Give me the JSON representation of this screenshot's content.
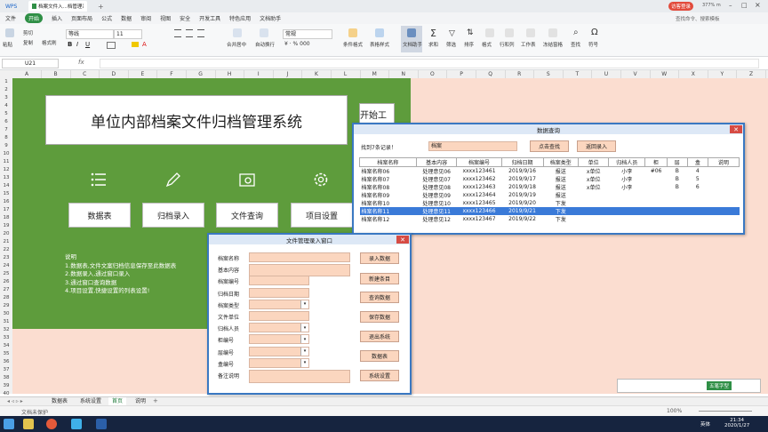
{
  "titlebar": {
    "app_label": "WPS",
    "tab_home": "首页",
    "doc_tab": "档案文件入...档管理系统",
    "login_btn": "访客登录",
    "time_label": "377% m"
  },
  "menubar": {
    "file": "文件",
    "start": "开始",
    "items": [
      "插入",
      "页面布局",
      "公式",
      "数据",
      "审阅",
      "视图",
      "安全",
      "开发工具",
      "特色应用",
      "文档助手"
    ],
    "search_placeholder": "查找命令、搜索模板"
  },
  "ribbon": {
    "cut": "剪切",
    "paste": "粘贴",
    "copy": "复制",
    "format_painter": "格式刷",
    "font_name": "等线",
    "font_size": "11",
    "merge": "合并居中",
    "wrap": "自动换行",
    "number_format": "常规",
    "cond_format": "条件格式",
    "table_style": "表格样式",
    "doc_helper": "文档助手",
    "sum": "求和",
    "filter": "筛选",
    "sort": "排序",
    "format": "格式",
    "rowcol": "行和列",
    "worksheet": "工作表",
    "freeze": "冻结窗格",
    "find": "查找",
    "symbol": "符号",
    "bold": "B",
    "italic": "I",
    "underline": "U"
  },
  "formula_bar": {
    "cell_ref": "U21",
    "fx": "fx"
  },
  "columns": [
    "A",
    "B",
    "C",
    "D",
    "E",
    "F",
    "G",
    "H",
    "I",
    "J",
    "K",
    "L",
    "M",
    "N",
    "O",
    "P",
    "Q",
    "R",
    "S",
    "T",
    "U",
    "V",
    "W",
    "X",
    "Y",
    "Z"
  ],
  "rows": [
    "1",
    "2",
    "3",
    "4",
    "5",
    "6",
    "7",
    "8",
    "9",
    "10",
    "11",
    "12",
    "13",
    "14",
    "15",
    "16",
    "17",
    "18",
    "19",
    "20",
    "21",
    "22",
    "23",
    "24",
    "25",
    "26",
    "27",
    "28",
    "29",
    "30",
    "31",
    "32",
    "33",
    "34",
    "35",
    "36",
    "37",
    "38",
    "39",
    "40"
  ],
  "main": {
    "system_title": "单位内部档案文件归档管理系统",
    "start_btn": "开始工作",
    "nav": [
      "数据表",
      "归档录入",
      "文件查询",
      "项目设置"
    ],
    "notes": [
      "说明",
      "1.数据表,文件文案归档信息保存至此数据表",
      "2.数据录入,通过窗口录入",
      "3.通过窗口查询数据",
      "4.项目设置,快捷设置的列表设置!"
    ]
  },
  "query_dialog": {
    "title": "数据查询",
    "found_label": "找到7条记录！",
    "search_value": "档案",
    "search_btn": "点击查找",
    "back_btn": "返回录入",
    "headers": [
      "档案名称",
      "基本内容",
      "档案编号",
      "归档日期",
      "档案类型",
      "单位",
      "归档人员",
      "柜",
      "层",
      "盒",
      "说明"
    ],
    "rows": [
      [
        "档案名称06",
        "处理意见06",
        "xxxx123461",
        "2019/9/16",
        "报送",
        "x单位",
        "小李",
        "#06",
        "B",
        "4",
        ""
      ],
      [
        "档案名称07",
        "处理意见07",
        "xxxx123462",
        "2019/9/17",
        "报送",
        "x单位",
        "小李",
        "",
        "B",
        "5",
        ""
      ],
      [
        "档案名称08",
        "处理意见08",
        "xxxx123463",
        "2019/9/18",
        "报送",
        "x单位",
        "小李",
        "",
        "B",
        "6",
        ""
      ],
      [
        "档案名称09",
        "处理意见09",
        "xxxx123464",
        "2019/9/19",
        "报送",
        "",
        "",
        "",
        "",
        "",
        ""
      ],
      [
        "档案名称10",
        "处理意见10",
        "xxxx123465",
        "2019/9/20",
        "下发",
        "",
        "",
        "",
        "",
        "",
        ""
      ],
      [
        "档案名称11",
        "处理意见11",
        "xxxx123466",
        "2019/9/21",
        "下发",
        "",
        "",
        "",
        "",
        "",
        ""
      ],
      [
        "档案名称12",
        "处理意见12",
        "xxxx123467",
        "2019/9/22",
        "下发",
        "",
        "",
        "",
        "",
        "",
        ""
      ]
    ]
  },
  "entry_dialog": {
    "title": "文件管理录入窗口",
    "labels": [
      "档案名称",
      "基本内容",
      "档案编号",
      "归档日期",
      "档案类型",
      "文件单位",
      "归档人员",
      "柜编号",
      "层编号",
      "盒编号",
      "备注说明"
    ],
    "buttons": [
      "录入数据",
      "新建条目",
      "查询数据",
      "保存数据",
      "退出系统",
      "数据表",
      "系统设置"
    ]
  },
  "sheet_tabs": [
    "数据表",
    "系统设置",
    "首页",
    "说明"
  ],
  "status": {
    "doc_protect": "文档未保护",
    "zoom": "100%",
    "ime": "五笔字型"
  },
  "taskbar": {
    "time": "21:34",
    "date": "2020/1/27",
    "lang": "英体"
  }
}
